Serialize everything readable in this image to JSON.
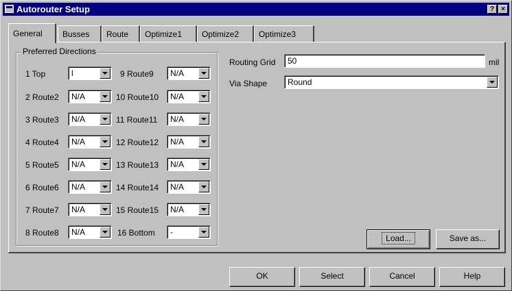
{
  "window": {
    "title": "Autorouter Setup",
    "help_glyph": "?",
    "close_glyph": "×"
  },
  "tabs": [
    {
      "label": "General",
      "active": true
    },
    {
      "label": "Busses"
    },
    {
      "label": "Route"
    },
    {
      "label": "Optimize1"
    },
    {
      "label": "Optimize2"
    },
    {
      "label": "Optimize3"
    }
  ],
  "preferred_directions": {
    "title": "Preferred Directions",
    "left": [
      {
        "label": "1 Top",
        "value": "l"
      },
      {
        "label": "2 Route2",
        "value": "N/A"
      },
      {
        "label": "3 Route3",
        "value": "N/A"
      },
      {
        "label": "4 Route4",
        "value": "N/A"
      },
      {
        "label": "5 Route5",
        "value": "N/A"
      },
      {
        "label": "6 Route6",
        "value": "N/A"
      },
      {
        "label": "7 Route7",
        "value": "N/A"
      },
      {
        "label": "8 Route8",
        "value": "N/A"
      }
    ],
    "right": [
      {
        "label": "9 Route9",
        "value": "N/A"
      },
      {
        "label": "10 Route10",
        "value": "N/A"
      },
      {
        "label": "11 Route11",
        "value": "N/A"
      },
      {
        "label": "12 Route12",
        "value": "N/A"
      },
      {
        "label": "13 Route13",
        "value": "N/A"
      },
      {
        "label": "14 Route14",
        "value": "N/A"
      },
      {
        "label": "15 Route15",
        "value": "N/A"
      },
      {
        "label": "16 Bottom",
        "value": "-"
      }
    ]
  },
  "routing_grid": {
    "label": "Routing Grid",
    "value": "50",
    "unit": "mil"
  },
  "via_shape": {
    "label": "Via Shape",
    "value": "Round"
  },
  "buttons": {
    "load": "Load...",
    "save_as": "Save as...",
    "ok": "OK",
    "select": "Select",
    "cancel": "Cancel",
    "help": "Help"
  }
}
